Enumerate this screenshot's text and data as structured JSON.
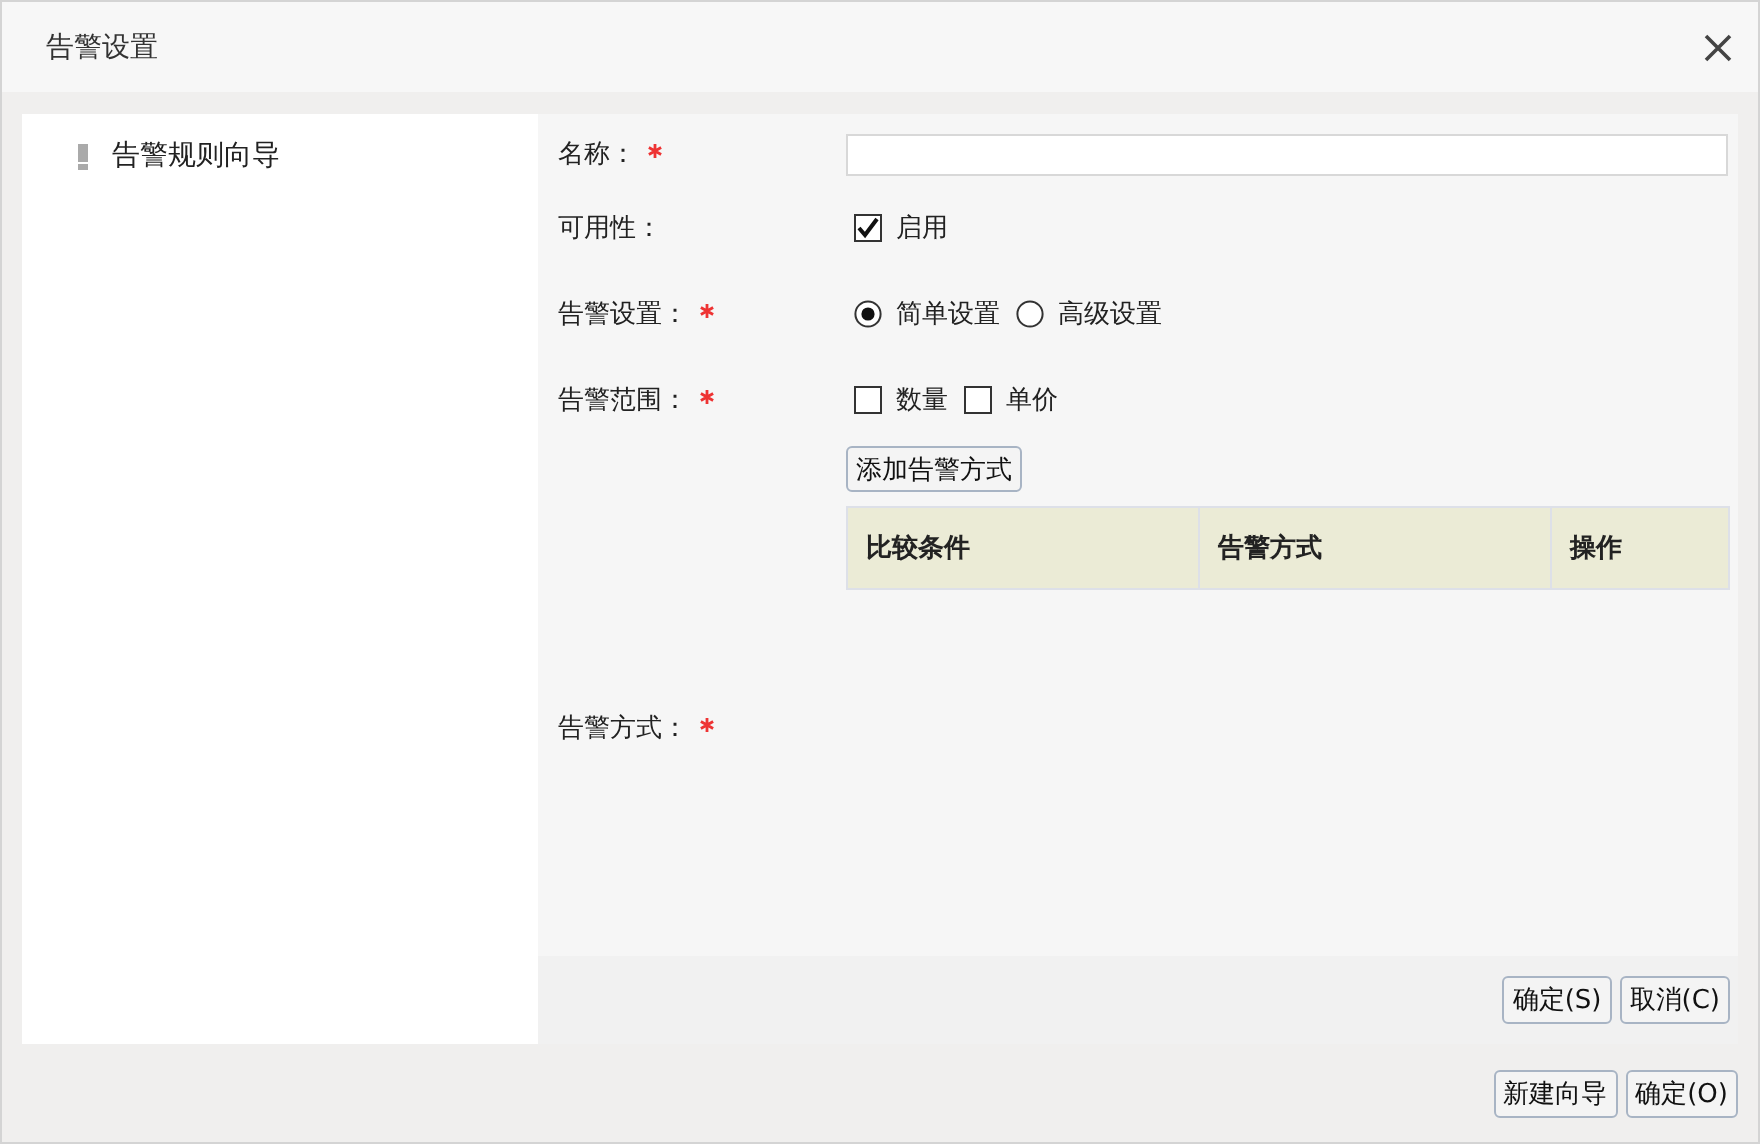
{
  "window": {
    "title": "告警设置"
  },
  "sidebar": {
    "items": [
      {
        "label": "告警规则向导",
        "selected": true
      }
    ]
  },
  "form": {
    "rows": [
      {
        "kind": "text",
        "label": "名称：",
        "required": true,
        "value": ""
      },
      {
        "kind": "checkboxes",
        "label": "可用性：",
        "required": false,
        "options": [
          {
            "label": "启用",
            "checked": true
          }
        ]
      },
      {
        "kind": "radios",
        "label": "告警设置：",
        "required": true,
        "options": [
          {
            "label": "简单设置",
            "selected": true
          },
          {
            "label": "高级设置",
            "selected": false
          }
        ]
      },
      {
        "kind": "checkboxes",
        "label": "告警范围：",
        "required": true,
        "options": [
          {
            "label": "数量",
            "checked": false
          },
          {
            "label": "单价",
            "checked": false
          }
        ]
      },
      {
        "kind": "table",
        "label": "告警方式：",
        "required": true,
        "button": "添加告警方式",
        "columns": [
          "比较条件",
          "告警方式",
          "操作"
        ]
      }
    ]
  },
  "panel_buttons": [
    "确定(S)",
    "取消(C)"
  ],
  "footer_buttons": [
    "新建向导",
    "确定(O)"
  ]
}
